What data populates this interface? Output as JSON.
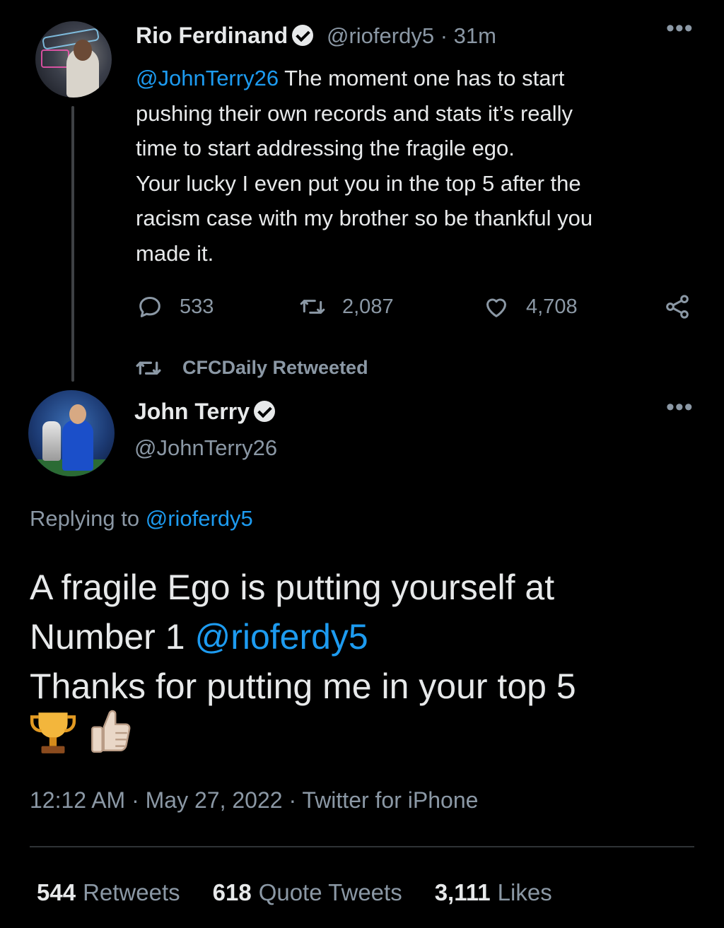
{
  "tweet1": {
    "author_name": "Rio Ferdinand",
    "handle": "@rioferdy5",
    "separator": "·",
    "time_ago": "31m",
    "more_label": "•••",
    "body_mention": "@JohnTerry26",
    "body_lines": [
      " The moment one has to start",
      "pushing their own records and stats it’s really",
      "time to start addressing the fragile ego.",
      "Your lucky I even put you in the top 5 after the",
      "racism case with my brother so be thankful you",
      "made it."
    ],
    "reply_count": "533",
    "retweet_count": "2,087",
    "like_count": "4,708"
  },
  "retweeted_by": "CFCDaily Retweeted",
  "tweet2": {
    "author_name": "John Terry",
    "handle": "@JohnTerry26",
    "more_label": "•••",
    "replying_prefix": "Replying to ",
    "replying_handle": "@rioferdy5",
    "line1": "A fragile Ego is putting yourself at",
    "line2_text": "Number 1 ",
    "line2_mention": "@rioferdy5",
    "line3": "Thanks for putting me in your top 5",
    "emojis": [
      "trophy-emoji",
      "thumbs-up-emoji"
    ],
    "timestamp": "12:12 AM · May 27, 2022 · Twitter for iPhone",
    "retweets_count": "544",
    "retweets_label": "Retweets",
    "quotes_count": "618",
    "quotes_label": "Quote Tweets",
    "likes_count": "3,111",
    "likes_label": "Likes"
  },
  "colors": {
    "background": "#000000",
    "text": "#e7e9ea",
    "muted": "#8b98a5",
    "link": "#1d9bf0",
    "divider": "#2f3336"
  }
}
